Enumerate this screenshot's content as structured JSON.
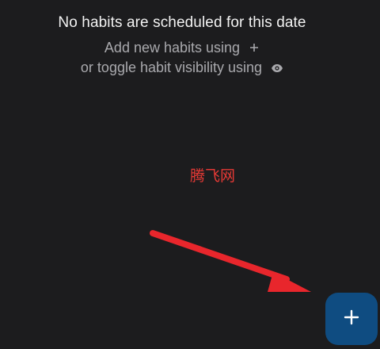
{
  "empty_state": {
    "title": "No habits are scheduled for this date",
    "line1": "Add new habits using",
    "line1_icon": "plus-icon",
    "line2": "or toggle habit visibility using",
    "line2_icon": "eye-icon"
  },
  "watermark": {
    "text": "腾飞网"
  },
  "fab": {
    "icon": "plus-icon",
    "color": "#0f4c81"
  },
  "annotation": {
    "arrow_color": "#e8262c"
  }
}
